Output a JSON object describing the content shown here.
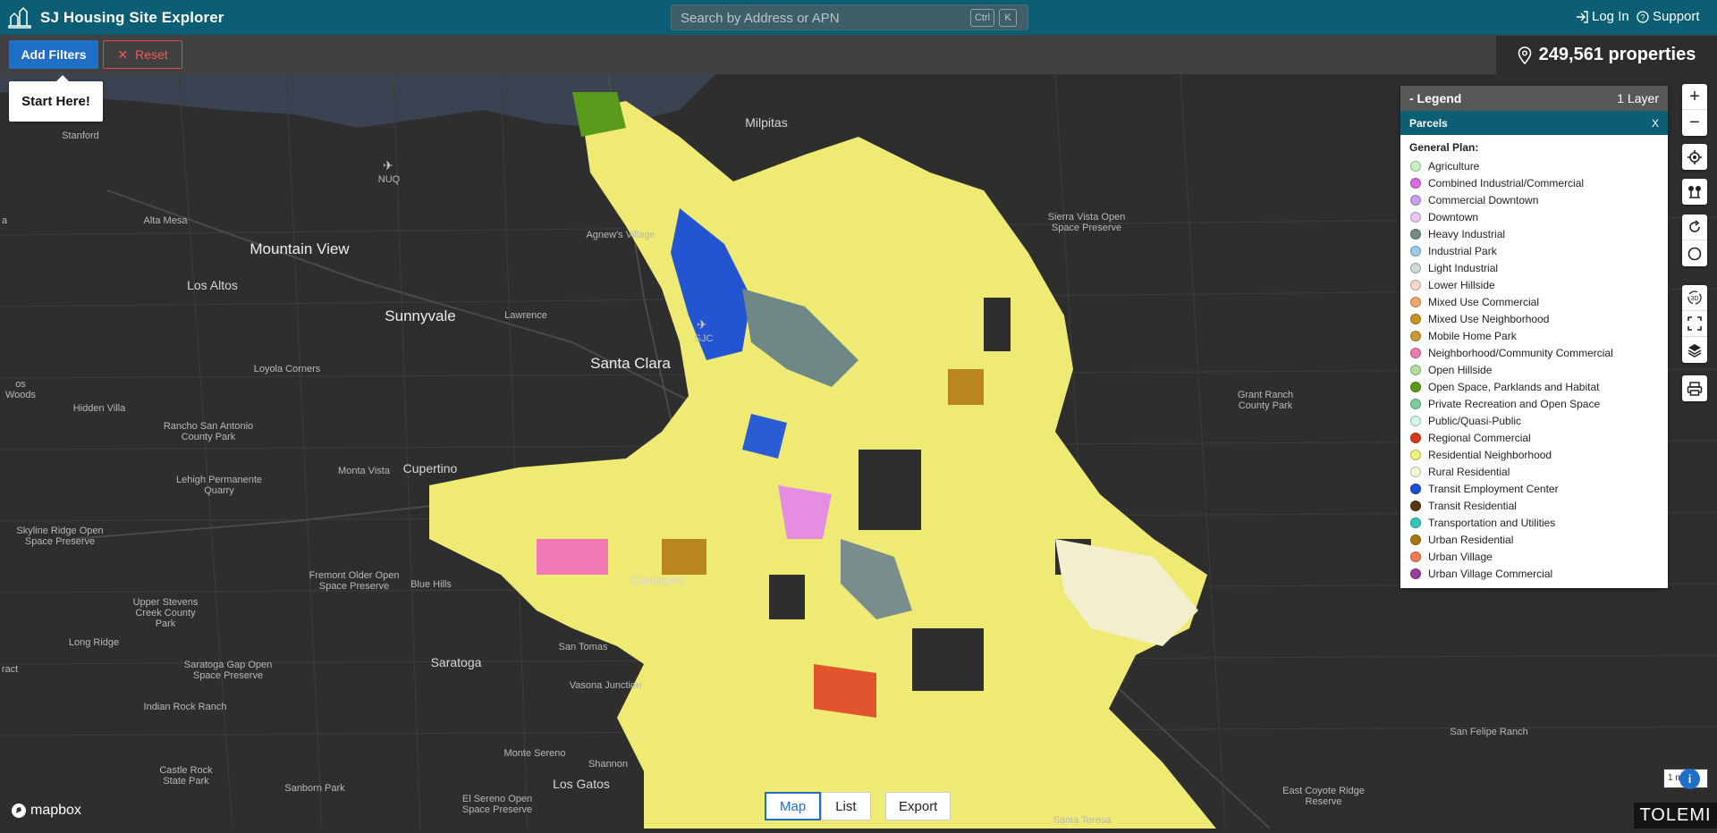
{
  "header": {
    "title": "SJ Housing Site Explorer",
    "search_placeholder": "Search by Address or APN",
    "kbd_ctrl": "Ctrl",
    "kbd_k": "K",
    "login": "Log In",
    "support": "Support"
  },
  "toolbar": {
    "add_filters": "Add Filters",
    "reset": "Reset",
    "property_count": "249,561 properties"
  },
  "tooltip": {
    "start": "Start Here!"
  },
  "legend": {
    "title": "- Legend",
    "layer_count": "1 Layer",
    "layer_name": "Parcels",
    "close": "X",
    "section": "General Plan:",
    "items": [
      {
        "label": "Agriculture",
        "color": "#c9f0c4"
      },
      {
        "label": "Combined Industrial/Commercial",
        "color": "#d76ae3"
      },
      {
        "label": "Commercial Downtown",
        "color": "#c7a0ef"
      },
      {
        "label": "Downtown",
        "color": "#e7c9f2"
      },
      {
        "label": "Heavy Industrial",
        "color": "#738a87"
      },
      {
        "label": "Industrial Park",
        "color": "#9dc9e8"
      },
      {
        "label": "Light Industrial",
        "color": "#cfd9d6"
      },
      {
        "label": "Lower Hillside",
        "color": "#f6d9cc"
      },
      {
        "label": "Mixed Use Commercial",
        "color": "#f1a66a"
      },
      {
        "label": "Mixed Use Neighborhood",
        "color": "#c99320"
      },
      {
        "label": "Mobile Home Park",
        "color": "#c89b33"
      },
      {
        "label": "Neighborhood/Community Commercial",
        "color": "#f07ab4"
      },
      {
        "label": "Open Hillside",
        "color": "#b5dd9a"
      },
      {
        "label": "Open Space, Parklands and Habitat",
        "color": "#5a9a1b"
      },
      {
        "label": "Private Recreation and Open Space",
        "color": "#7ccf9c"
      },
      {
        "label": "Public/Quasi-Public",
        "color": "#d6f6f4"
      },
      {
        "label": "Regional Commercial",
        "color": "#d93a17"
      },
      {
        "label": "Residential Neighborhood",
        "color": "#f3f37a"
      },
      {
        "label": "Rural Residential",
        "color": "#f8f7d8"
      },
      {
        "label": "Transit Employment Center",
        "color": "#1d4fd6"
      },
      {
        "label": "Transit Residential",
        "color": "#5a3510"
      },
      {
        "label": "Transportation and Utilities",
        "color": "#30c7bf"
      },
      {
        "label": "Urban Residential",
        "color": "#a8770f"
      },
      {
        "label": "Urban Village",
        "color": "#f47b52"
      },
      {
        "label": "Urban Village Commercial",
        "color": "#9b3c9b"
      }
    ]
  },
  "map_labels": [
    {
      "text": "Milpitas",
      "cls": "mid"
    },
    {
      "text": "Stanford",
      "cls": ""
    },
    {
      "text": "NUQ",
      "cls": ""
    },
    {
      "text": "Mountain View",
      "cls": "big"
    },
    {
      "text": "Alta Mesa",
      "cls": ""
    },
    {
      "text": "Agnew's Village",
      "cls": ""
    },
    {
      "text": "Los Altos",
      "cls": "mid"
    },
    {
      "text": "Sunnyvale",
      "cls": "big"
    },
    {
      "text": "Lawrence",
      "cls": ""
    },
    {
      "text": "SJC",
      "cls": ""
    },
    {
      "text": "Santa Clara",
      "cls": "big"
    },
    {
      "text": "Loyola Corners",
      "cls": ""
    },
    {
      "text": "os Woods",
      "cls": ""
    },
    {
      "text": "Hidden Villa",
      "cls": ""
    },
    {
      "text": "Rancho San Antonio County Park",
      "cls": ""
    },
    {
      "text": "Lehigh Permanente Quarry",
      "cls": ""
    },
    {
      "text": "Monta Vista",
      "cls": ""
    },
    {
      "text": "Cupertino",
      "cls": "mid"
    },
    {
      "text": "Skyline Ridge Open Space Preserve",
      "cls": ""
    },
    {
      "text": "Fremont Older Open Space Preserve",
      "cls": ""
    },
    {
      "text": "Blue Hills",
      "cls": ""
    },
    {
      "text": "Campbell",
      "cls": "mid"
    },
    {
      "text": "Upper Stevens Creek County Park",
      "cls": ""
    },
    {
      "text": "Long Ridge",
      "cls": ""
    },
    {
      "text": "Saratoga",
      "cls": "mid"
    },
    {
      "text": "San Tomas",
      "cls": ""
    },
    {
      "text": "Saratoga Gap Open Space Preserve",
      "cls": ""
    },
    {
      "text": "Indian Rock Ranch",
      "cls": ""
    },
    {
      "text": "Vasona Junction",
      "cls": ""
    },
    {
      "text": "Monte Sereno",
      "cls": ""
    },
    {
      "text": "Shannon",
      "cls": ""
    },
    {
      "text": "Los Gatos",
      "cls": "mid"
    },
    {
      "text": "Castle Rock State Park",
      "cls": ""
    },
    {
      "text": "Sanborn Park",
      "cls": ""
    },
    {
      "text": "El Sereno Open Space Preserve",
      "cls": ""
    },
    {
      "text": "Sierra Vista Open Space Preserve",
      "cls": ""
    },
    {
      "text": "Grant Ranch County Park",
      "cls": ""
    },
    {
      "text": "San Felipe Ranch",
      "cls": ""
    },
    {
      "text": "East Coyote Ridge Reserve",
      "cls": ""
    },
    {
      "text": "Santa Teresa",
      "cls": ""
    },
    {
      "text": "ract",
      "cls": ""
    },
    {
      "text": "a",
      "cls": ""
    }
  ],
  "view": {
    "map": "Map",
    "list": "List",
    "export": "Export"
  },
  "footer": {
    "mapbox": "mapbox",
    "tolemi": "TOLEMI",
    "scale": "1 mi",
    "info": "i"
  }
}
